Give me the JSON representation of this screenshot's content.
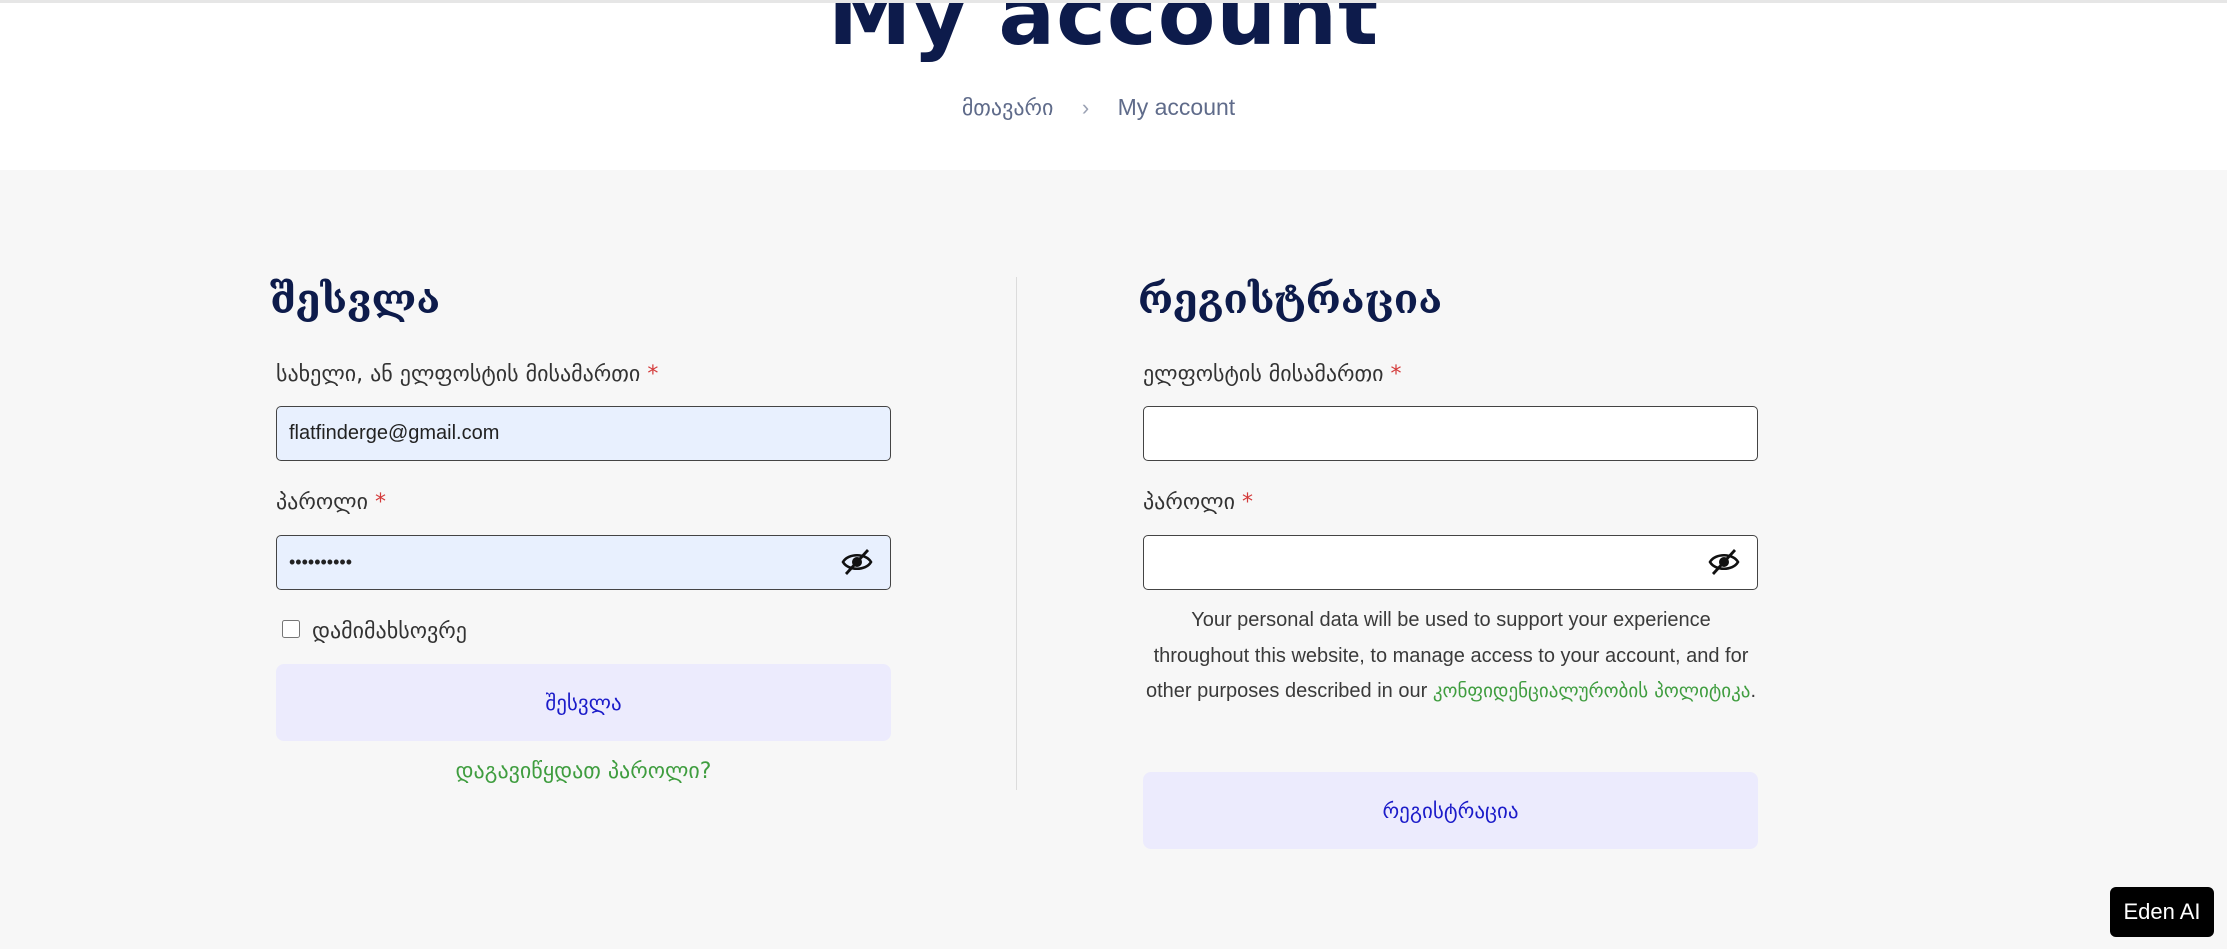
{
  "header": {
    "title": "My account",
    "breadcrumb": {
      "home": "მთავარი",
      "separator": "›",
      "current": "My account"
    }
  },
  "login": {
    "heading": "შესვლა",
    "username_label": "სახელი, ან ელფოსტის მისამართი",
    "username_required": "*",
    "username_value": "flatfinderge@gmail.com",
    "password_label": "პაროლი",
    "password_required": "*",
    "password_value": "••••••••••",
    "remember_label": "დამიმახსოვრე",
    "remember_checked": false,
    "submit_label": "შესვლა",
    "forgot_label": "დაგავიწყდათ პაროლი?"
  },
  "register": {
    "heading": "რეგისტრაცია",
    "email_label": "ელფოსტის მისამართი",
    "email_required": "*",
    "email_value": "",
    "password_label": "პაროლი",
    "password_required": "*",
    "password_value": "",
    "privacy_text": "Your personal data will be used to support your experience throughout this website, to manage access to your account, and for other purposes described in our",
    "privacy_link": "კონფიდენციალურობის პოლიტიკა",
    "privacy_end": ".",
    "submit_label": "რეგისტრაცია"
  },
  "badge": {
    "label": "Eden AI"
  },
  "colors": {
    "title": "#0d1b4b",
    "required": "#d43b3b",
    "link": "#3f9d3f",
    "button_bg": "#ecebfd",
    "button_text": "#1b1bc9",
    "autofill_bg": "#e8f0fe"
  },
  "icons": {
    "password_toggle": "eye-slash-icon"
  }
}
